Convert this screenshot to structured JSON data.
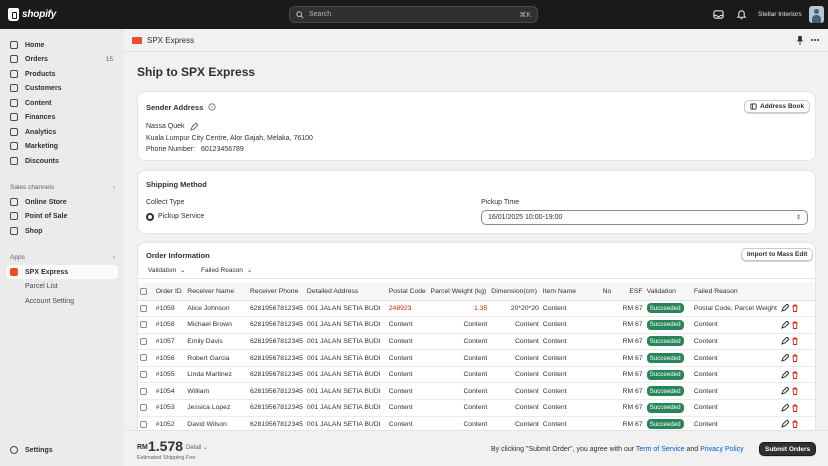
{
  "topbar": {
    "brand": "shopify",
    "search_placeholder": "Search",
    "search_shortcut": "⌘K",
    "store_name": "Stellar Interiors"
  },
  "sidebar": {
    "items": [
      {
        "label": "Home",
        "icon": "home-icon"
      },
      {
        "label": "Orders",
        "icon": "orders-icon",
        "badge": "15"
      },
      {
        "label": "Products",
        "icon": "products-icon"
      },
      {
        "label": "Customers",
        "icon": "customers-icon"
      },
      {
        "label": "Content",
        "icon": "content-icon"
      },
      {
        "label": "Finances",
        "icon": "finances-icon"
      },
      {
        "label": "Analytics",
        "icon": "analytics-icon"
      },
      {
        "label": "Marketing",
        "icon": "marketing-icon"
      },
      {
        "label": "Discounts",
        "icon": "discounts-icon"
      }
    ],
    "sales_channels_label": "Sales channels",
    "channels": [
      "Online Store",
      "Point of Sale",
      "Shop"
    ],
    "apps_label": "Apps",
    "app_active": "SPX Express",
    "app_subitems": [
      "Parcel List",
      "Account Setting"
    ],
    "settings_label": "Settings"
  },
  "app_header": {
    "title": "SPX Express"
  },
  "page": {
    "title": "Ship to SPX Express",
    "sender": {
      "title": "Sender Address",
      "address_book_label": "Address Book",
      "name": "Nassa Quek",
      "address": "Kuala Lumpur City Centre, Alor Gajah, Melaka, 76100",
      "phone_label": "Phone Number:",
      "phone": "60123456789"
    },
    "shipping": {
      "title": "Shipping Method",
      "collect_type_label": "Collect Type",
      "collect_option": "Pickup Service",
      "pickup_time_label": "Pickup Time",
      "pickup_time_value": "16/01/2025 10:00-19:00"
    },
    "orders": {
      "title": "Order Information",
      "import_label": "Import to Mass Edit",
      "tabs": [
        "Validation",
        "Failed Reason"
      ],
      "columns": [
        "Order ID",
        "Receiver Name",
        "Receiver Phone",
        "Detailed Address",
        "Postal Code",
        "Parcel Weight (kg)",
        "Dimension(cm)",
        "Item Name",
        "No",
        "ESF",
        "Validation",
        "Failed Reason"
      ],
      "rows": [
        {
          "id": "#1059",
          "name": "Alice Johnson",
          "phone": "62819567812345",
          "address": "001 JALAN SETIA BUDI",
          "postal": "248923",
          "weight": "1.35",
          "dimension": "20*20*20",
          "item": "Content",
          "esf": "RM 67",
          "status": "Succeeded",
          "reason": "Postal Code, Parcel Weight",
          "postal_red": true,
          "weight_red": true
        },
        {
          "id": "#1058",
          "name": "Michael Brown",
          "phone": "62819567812345",
          "address": "001 JALAN SETIA BUDI",
          "postal": "Content",
          "weight": "Content",
          "dimension": "Content",
          "item": "Content",
          "esf": "RM 67",
          "status": "Succeeded",
          "reason": "Content"
        },
        {
          "id": "#1057",
          "name": "Emily Davis",
          "phone": "62819567812345",
          "address": "001 JALAN SETIA BUDI",
          "postal": "Content",
          "weight": "Content",
          "dimension": "Content",
          "item": "Content",
          "esf": "RM 67",
          "status": "Succeeded",
          "reason": "Content"
        },
        {
          "id": "#1056",
          "name": "Robert Garcia",
          "phone": "62819567812345",
          "address": "001 JALAN SETIA BUDI",
          "postal": "Content",
          "weight": "Content",
          "dimension": "Content",
          "item": "Content",
          "esf": "RM 67",
          "status": "Succeeded",
          "reason": "Content"
        },
        {
          "id": "#1055",
          "name": "Linda Martinez",
          "phone": "62819567812345",
          "address": "001 JALAN SETIA BUDI",
          "postal": "Content",
          "weight": "Content",
          "dimension": "Content",
          "item": "Content",
          "esf": "RM 67",
          "status": "Succeeded",
          "reason": "Content"
        },
        {
          "id": "#1054",
          "name": "William",
          "phone": "62819567812345",
          "address": "001 JALAN SETIA BUDI",
          "postal": "Content",
          "weight": "Content",
          "dimension": "Content",
          "item": "Content",
          "esf": "RM 67",
          "status": "Succeeded",
          "reason": "Content"
        },
        {
          "id": "#1053",
          "name": "Jessica Lopez",
          "phone": "62819567812345",
          "address": "001 JALAN SETIA BUDI",
          "postal": "Content",
          "weight": "Content",
          "dimension": "Content",
          "item": "Content",
          "esf": "RM 67",
          "status": "Succeeded",
          "reason": "Content"
        },
        {
          "id": "#1052",
          "name": "David Wilson",
          "phone": "62819567812345",
          "address": "001 JALAN SETIA BUDI",
          "postal": "Content",
          "weight": "Content",
          "dimension": "Content",
          "item": "Content",
          "esf": "RM 67",
          "status": "Succeeded",
          "reason": "Content"
        }
      ]
    }
  },
  "footer": {
    "currency": "RM",
    "fee": "1.578",
    "detail_label": "Detail",
    "fee_label": "Estimated Shipping Fee",
    "agree_prefix": "By clicking \"Submit Order\", you agree with our ",
    "terms_link": "Term of Service",
    "and": " and ",
    "privacy_link": "Privacy Policy",
    "submit_label": "Submit Orders"
  },
  "colors": {
    "success": "#29845a",
    "error": "#c5280c",
    "link": "#005bd3",
    "topbar": "#1a1a1a"
  }
}
